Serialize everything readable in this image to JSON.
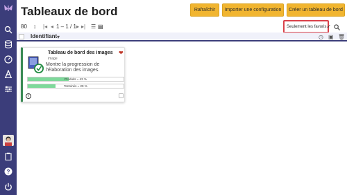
{
  "page": {
    "title": "Tableaux de bord"
  },
  "toolbar": {
    "refresh_label": "Rafraîchir",
    "import_label": "Importer une configuration",
    "create_label": "Créer un tableau de bord",
    "page_size": "80",
    "pagination": "1 – 1 / 1",
    "favorites_filter": "Seulement les favoris"
  },
  "sort": {
    "column_label": "Identifiant"
  },
  "card": {
    "title": "Tableau de bord des images",
    "subtitle": "image",
    "description": "Montre la progression de l'élaboration des images.",
    "progress_produced_label": "Produits = 43 %",
    "progress_produced_value": 43,
    "progress_finished_label": "Terminés = 29 %",
    "progress_finished_value": 29,
    "favorite": true
  },
  "colors": {
    "sidebar": "#3b3d7a",
    "accent_button": "#f1b530",
    "highlight_box": "#d9414a",
    "progress_fill": "#7dd99a",
    "card_border": "#3a8a55"
  },
  "sidebar": {
    "icons": [
      "logo-icon",
      "search-icon",
      "database-icon",
      "gauge-icon",
      "a-letter-icon",
      "sliders-icon",
      "avatar",
      "clipboard-icon",
      "help-icon",
      "power-icon"
    ]
  }
}
